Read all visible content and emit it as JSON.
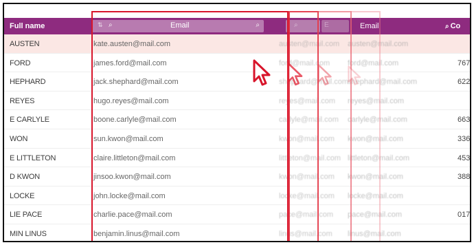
{
  "header": {
    "full_name": "Full name",
    "email": "Email",
    "email_ghost1": "E",
    "email_ghost2": "E",
    "email_2": "Email",
    "col_partial": "Co"
  },
  "icons": {
    "sort": "sort-icon",
    "search": "search-icon",
    "cursor": "cursor-icon"
  },
  "rows": [
    {
      "name": "AUSTEN",
      "email": "kate.austen@mail.com",
      "ghost": "austen@mail.com",
      "num": ""
    },
    {
      "name": "FORD",
      "email": "james.ford@mail.com",
      "ghost": "ford@mail.com",
      "num": "767"
    },
    {
      "name": "HEPHARD",
      "email": "jack.shephard@mail.com",
      "ghost": "shephard@mail.com",
      "num": "622"
    },
    {
      "name": "REYES",
      "email": "hugo.reyes@mail.com",
      "ghost": "reyes@mail.com",
      "num": ""
    },
    {
      "name": "E CARLYLE",
      "email": "boone.carlyle@mail.com",
      "ghost": "carlyle@mail.com",
      "num": "663"
    },
    {
      "name": "WON",
      "email": "sun.kwon@mail.com",
      "ghost": "kwon@mail.com",
      "num": "336"
    },
    {
      "name": "E LITTLETON",
      "email": "claire.littleton@mail.com",
      "ghost": "littleton@mail.com",
      "num": "453"
    },
    {
      "name": "D KWON",
      "email": "jinsoo.kwon@mail.com",
      "ghost": "kwon@mail.com",
      "num": "388"
    },
    {
      "name": "LOCKE",
      "email": "john.locke@mail.com",
      "ghost": "locke@mail.com",
      "num": ""
    },
    {
      "name": "LIE PACE",
      "email": "charlie.pace@mail.com",
      "ghost": "pace@mail.com",
      "num": "017"
    },
    {
      "name": "MIN LINUS",
      "email": "benjamin.linus@mail.com",
      "ghost": "linus@mail.com",
      "num": ""
    }
  ]
}
